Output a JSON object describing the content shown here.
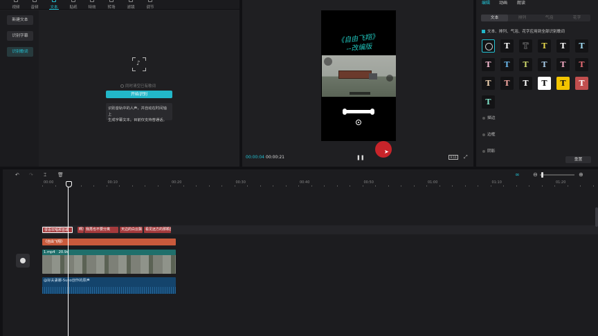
{
  "topnav": [
    {
      "label": "视频"
    },
    {
      "label": "音频"
    },
    {
      "label": "文本"
    },
    {
      "label": "贴纸"
    },
    {
      "label": "特效"
    },
    {
      "label": "转场"
    },
    {
      "label": "滤镜"
    },
    {
      "label": "调节"
    }
  ],
  "sidebar": {
    "items": [
      {
        "label": "新建文本"
      },
      {
        "label": "识别字幕"
      },
      {
        "label": "识别歌词"
      }
    ]
  },
  "recognize": {
    "clear_checkbox": "同时清空已有歌词",
    "start_button": "开始识别",
    "tip_line1": "识别音轨中的人声，并自动在时间轴上",
    "tip_line2": "生成字幕文本。目前仅支持普通话。"
  },
  "player": {
    "title_line1": "《自由飞翔》",
    "title_line2": "--改编版",
    "current_time": "00:00:04",
    "total_time": "00:00:21",
    "pause_icon": "pause-icon",
    "ratio_label": "9:16",
    "fullscreen_icon": "fullscreen-icon"
  },
  "right": {
    "tabs": [
      {
        "label": "编辑"
      },
      {
        "label": "动画"
      },
      {
        "label": "朗读"
      }
    ],
    "subtabs": [
      {
        "label": "文本"
      },
      {
        "label": "排列"
      },
      {
        "label": "气泡"
      },
      {
        "label": "花字"
      }
    ],
    "apply_all": "文本、排列、气泡、花字应用到全部识别歌词",
    "presets": [
      {
        "glyph": "",
        "fg": "#ffffff",
        "bg": "#131315"
      },
      {
        "glyph": "T",
        "fg": "#ffffff",
        "bg": "#131315"
      },
      {
        "glyph": "T",
        "fg": "#1b1b1d",
        "bg": "#131315"
      },
      {
        "glyph": "T",
        "fg": "#e3d44a",
        "bg": "#131315"
      },
      {
        "glyph": "T",
        "fg": "#ffffff",
        "bg": "#131315"
      },
      {
        "glyph": "T",
        "fg": "#9fd8f0",
        "bg": "#131315"
      },
      {
        "glyph": "T",
        "fg": "#f4b9cf",
        "bg": "#131315"
      },
      {
        "glyph": "T",
        "fg": "#69b5e8",
        "bg": "#131315"
      },
      {
        "glyph": "T",
        "fg": "#cfd86d",
        "bg": "#131315"
      },
      {
        "glyph": "T",
        "fg": "#a7c9e6",
        "bg": "#131315"
      },
      {
        "glyph": "T",
        "fg": "#f0a7c0",
        "bg": "#131315"
      },
      {
        "glyph": "T",
        "fg": "#e36a72",
        "bg": "#131315"
      },
      {
        "glyph": "T",
        "fg": "#f3d5b2",
        "bg": "#131315"
      },
      {
        "glyph": "T",
        "fg": "#f2a6a0",
        "bg": "#131315"
      },
      {
        "glyph": "T",
        "fg": "#ffffff",
        "bg": "#131315"
      },
      {
        "glyph": "T",
        "fg": "#000000",
        "bg": "#ffffff"
      },
      {
        "glyph": "T",
        "fg": "#111111",
        "bg": "#f2c400"
      },
      {
        "glyph": "T",
        "fg": "#ffffff",
        "bg": "#c14e4e"
      },
      {
        "glyph": "T",
        "fg": "#7ee0c6",
        "bg": "#131315"
      }
    ],
    "sections": [
      {
        "label": "描边"
      },
      {
        "label": "边框"
      },
      {
        "label": "阴影"
      }
    ],
    "reset_button": "重置"
  },
  "timeline": {
    "ticks": [
      "00:00",
      "00:10",
      "00:20",
      "00:30",
      "00:40",
      "00:50",
      "01:00",
      "01:10",
      "01:20"
    ],
    "subtitle_clips": [
      {
        "label": "很喜欢唱那首歌"
      },
      {
        "label": "啊3"
      },
      {
        "label": "我再也不要分离"
      },
      {
        "label": "天边的白云飘"
      },
      {
        "label": "看见远方的那颗星"
      }
    ],
    "text_clip": "《自由飞翔》",
    "video_clip": {
      "name": "1.mp4",
      "duration": "20.9s"
    },
    "audio_clip": "@好夫妻娜-Suno创作的原声"
  },
  "colors": {
    "accent": "#22c3d6",
    "record": "#c8242a"
  }
}
